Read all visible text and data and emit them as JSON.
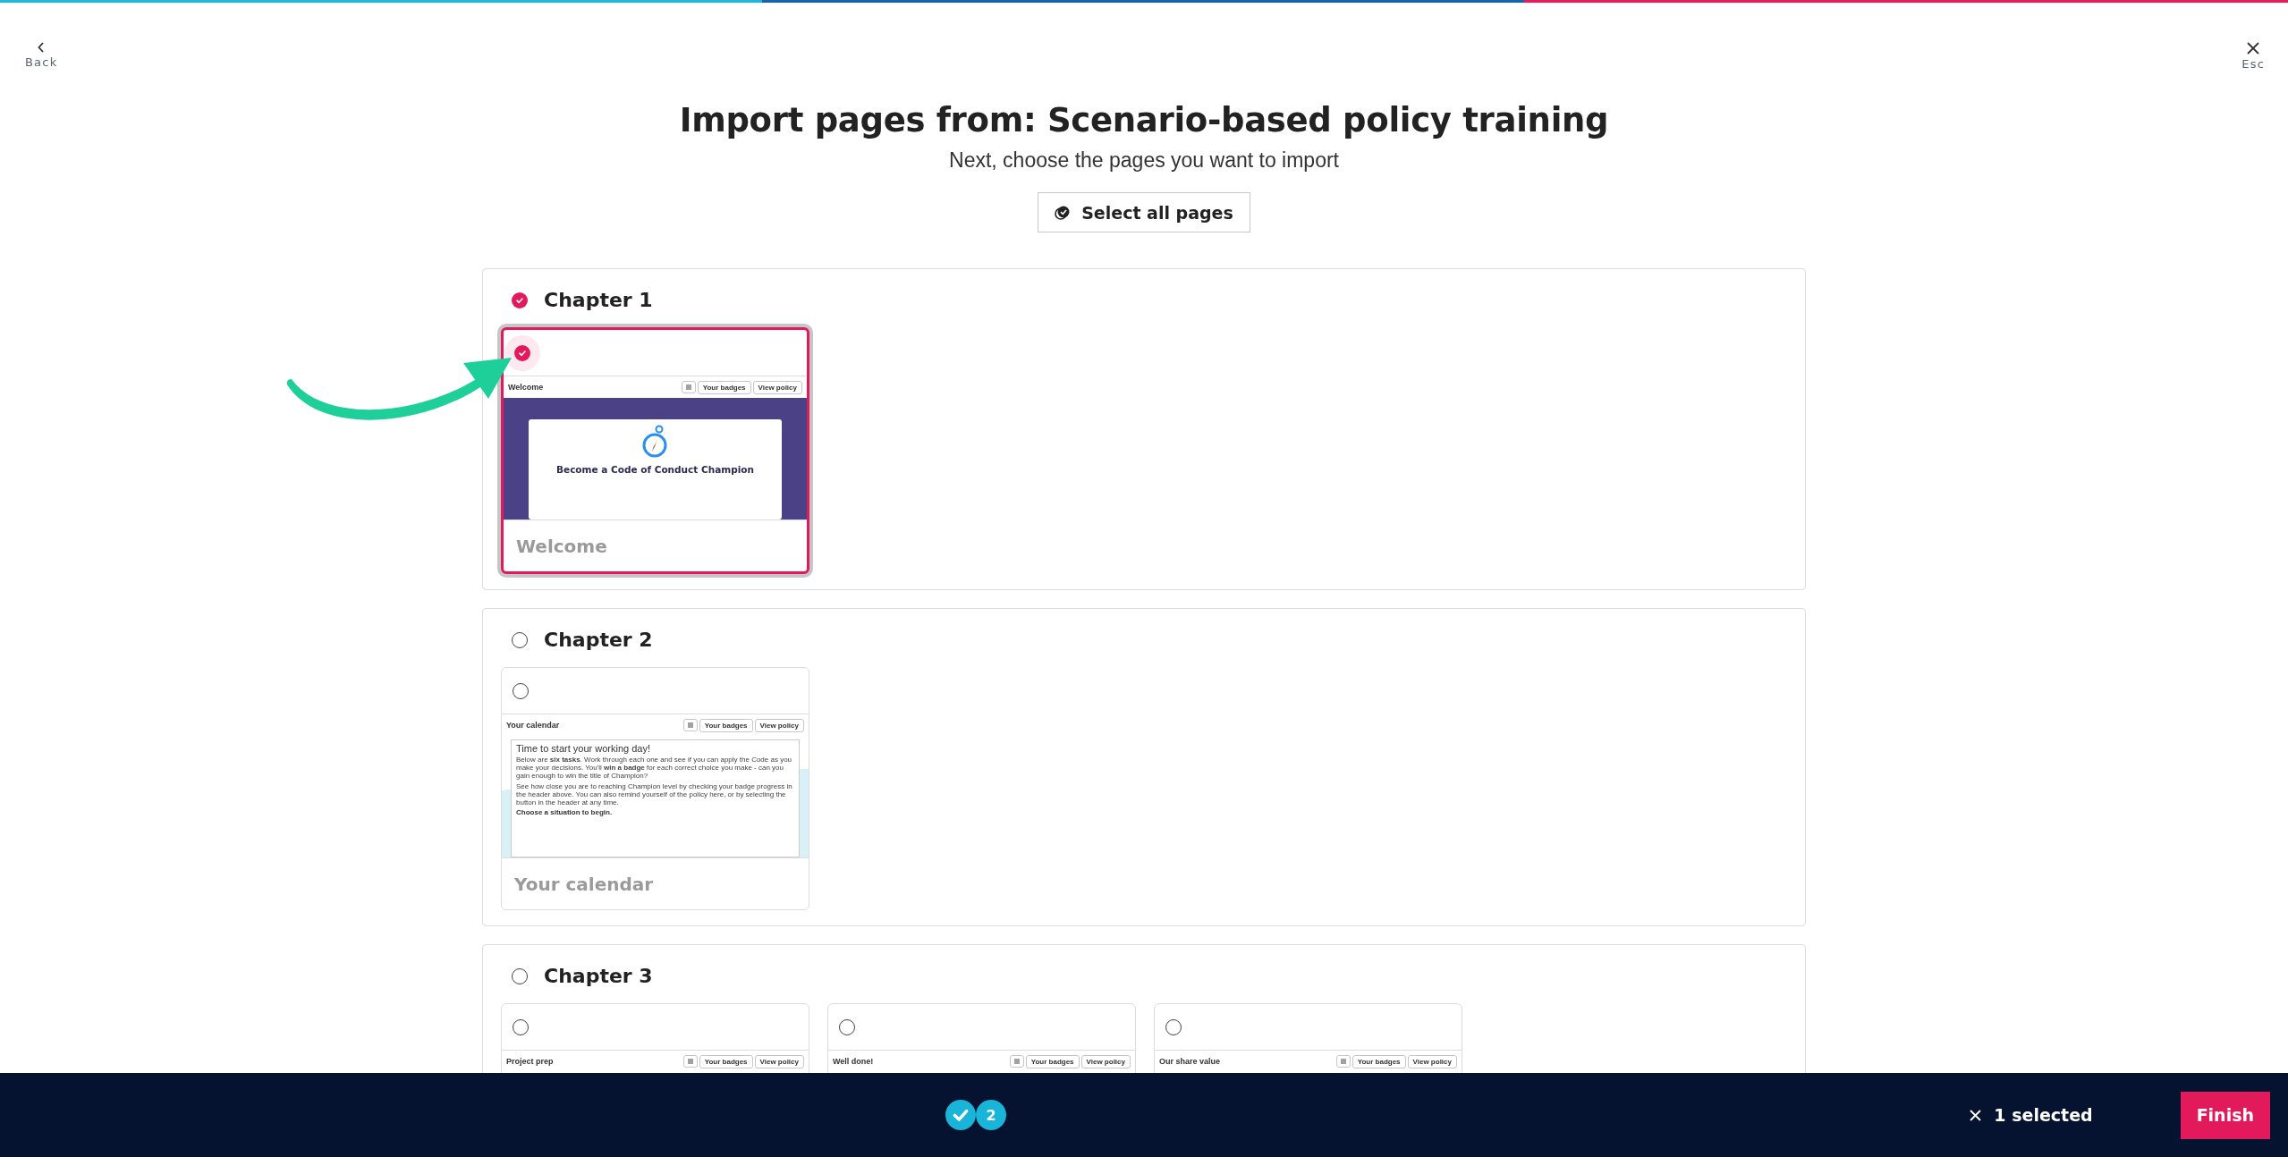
{
  "nav": {
    "back": "Back",
    "close": "Esc"
  },
  "title": "Import pages from: Scenario-based policy training",
  "subtitle": "Next, choose the pages you want to import",
  "select_all_button": "Select all pages",
  "chapters": [
    {
      "title": "Chapter 1",
      "selected": true,
      "pages": [
        {
          "label": "Welcome",
          "selected": true,
          "preview": {
            "kind": "welcome",
            "header": "Welcome",
            "buttons": [
              "Your badges",
              "View policy"
            ],
            "heading": "Become a Code of Conduct Champion"
          }
        }
      ]
    },
    {
      "title": "Chapter 2",
      "selected": false,
      "pages": [
        {
          "label": "Your calendar",
          "selected": false,
          "preview": {
            "kind": "calendar",
            "header": "Your calendar",
            "buttons": [
              "Your badges",
              "View policy"
            ],
            "heading": "Time to start your working day!",
            "paragraphs": [
              "Below are **six tasks**. Work through each one and see if you can apply the Code as you make your decisions. You'll **win a badge** for each correct choice you make - can you gain enough to win the title of Champion?",
              "See how close you are to reaching Champion level by checking your badge progress in the header above. You can also remind yourself of the policy here, or by selecting the button in the header at any time."
            ],
            "closing": "Choose a situation to begin."
          }
        }
      ]
    },
    {
      "title": "Chapter 3",
      "selected": false,
      "pages": [
        {
          "selected": false,
          "preview": {
            "kind": "header",
            "header": "Project prep",
            "buttons": [
              "Your badges",
              "View policy"
            ]
          }
        },
        {
          "selected": false,
          "preview": {
            "kind": "header",
            "header": "Well done!",
            "buttons": [
              "Your badges",
              "View policy"
            ]
          }
        },
        {
          "selected": false,
          "preview": {
            "kind": "header",
            "header": "Our share value",
            "buttons": [
              "Your badges",
              "View policy"
            ]
          }
        }
      ]
    }
  ],
  "footer": {
    "steps": [
      {
        "completed": true
      },
      {
        "completed": false,
        "label": "2"
      }
    ],
    "selected_count": "1 selected",
    "finish_button": "Finish"
  }
}
